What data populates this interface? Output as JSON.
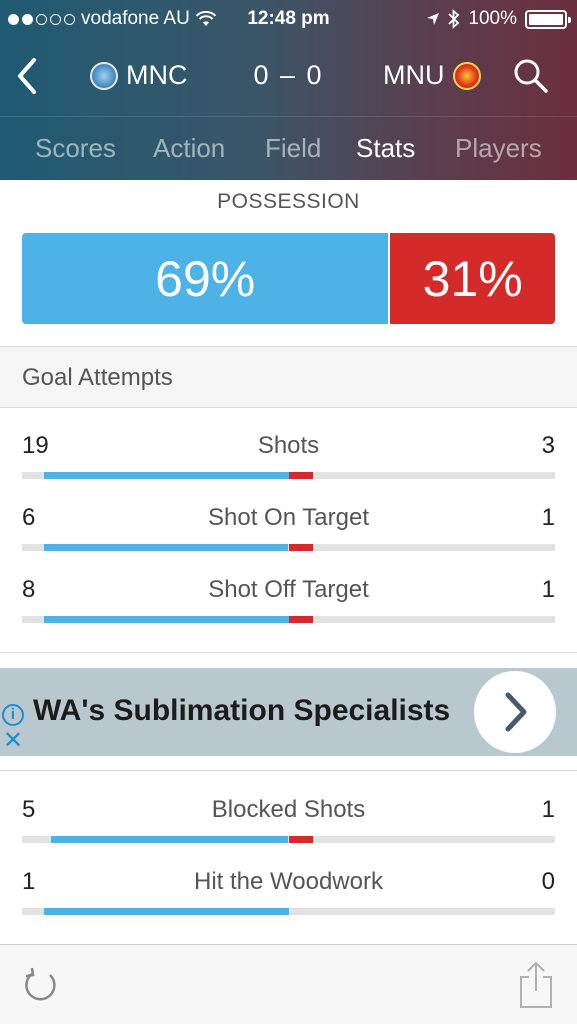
{
  "status_bar": {
    "carrier": "vodafone AU",
    "time": "12:48 pm",
    "battery": "100%",
    "signal_bars_filled": 2,
    "signal_bars_total": 5
  },
  "match": {
    "home_team": "MNC",
    "away_team": "MNU",
    "score": "0 – 0",
    "home_color": "#4db3e6",
    "away_color": "#d52a2a"
  },
  "tabs": [
    {
      "label": "Scores",
      "active": false
    },
    {
      "label": "Action",
      "active": false
    },
    {
      "label": "Field",
      "active": false
    },
    {
      "label": "Stats",
      "active": true
    },
    {
      "label": "Players",
      "active": false
    }
  ],
  "possession": {
    "title": "POSSESSION",
    "home": 69,
    "away": 31,
    "home_label": "69%",
    "away_label": "31%"
  },
  "goal_attempts": {
    "title": "Goal Attempts",
    "stats": [
      {
        "label": "Shots",
        "home": 19,
        "away": 3
      },
      {
        "label": "Shot On Target",
        "home": 6,
        "away": 1
      },
      {
        "label": "Shot Off Target",
        "home": 8,
        "away": 1
      }
    ]
  },
  "ad": {
    "headline": "WA's Sublimation Specialists",
    "info_icon": "i",
    "close_icon": "✕"
  },
  "more_stats": [
    {
      "label": "Blocked Shots",
      "home": 5,
      "away": 1
    },
    {
      "label": "Hit the Woodwork",
      "home": 1,
      "away": 0
    }
  ],
  "icons": {
    "back": "chevron-left-icon",
    "search": "search-icon",
    "refresh": "refresh-icon",
    "share": "share-icon"
  }
}
